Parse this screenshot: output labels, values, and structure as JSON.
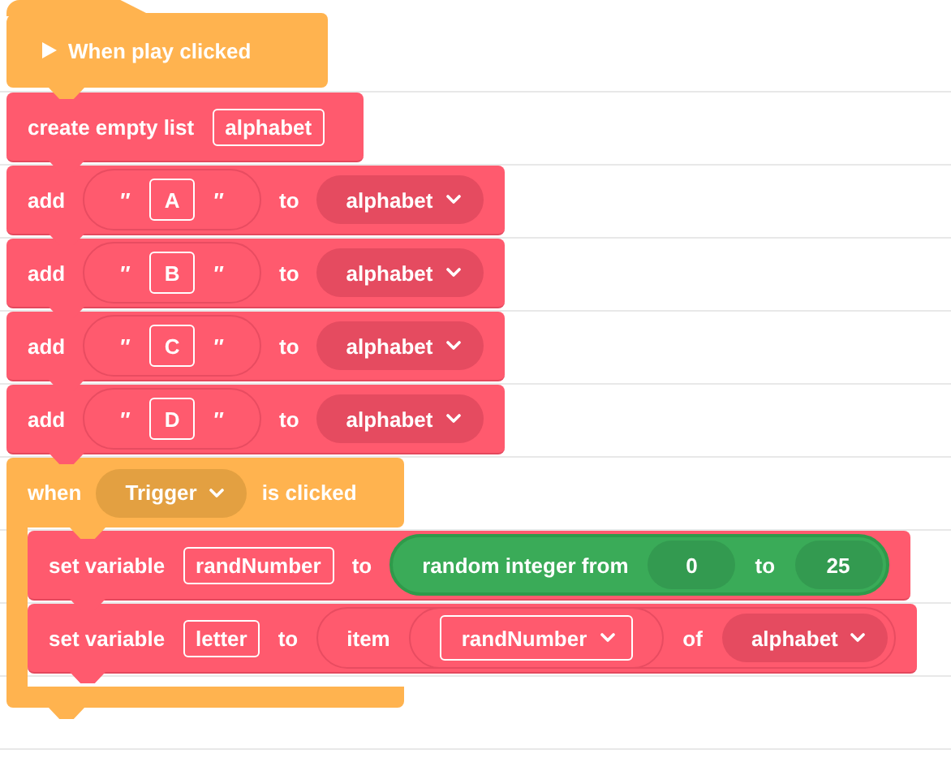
{
  "scripts": [
    {
      "hat": {
        "kind": "play",
        "label": "When play clicked"
      },
      "blocks": [
        {
          "kind": "command",
          "parts": [
            {
              "kind": "label",
              "text": "create empty list"
            },
            {
              "kind": "field",
              "text": "alphabet"
            }
          ]
        },
        {
          "kind": "command",
          "parts": [
            {
              "kind": "label",
              "text": "add"
            },
            {
              "kind": "string",
              "open": "″",
              "value": "A",
              "close": "″"
            },
            {
              "kind": "label",
              "text": "to"
            },
            {
              "kind": "dropdown",
              "text": "alphabet"
            }
          ]
        },
        {
          "kind": "command",
          "parts": [
            {
              "kind": "label",
              "text": "add"
            },
            {
              "kind": "string",
              "open": "″",
              "value": "B",
              "close": "″"
            },
            {
              "kind": "label",
              "text": "to"
            },
            {
              "kind": "dropdown",
              "text": "alphabet"
            }
          ]
        },
        {
          "kind": "command",
          "parts": [
            {
              "kind": "label",
              "text": "add"
            },
            {
              "kind": "string",
              "open": "″",
              "value": "C",
              "close": "″"
            },
            {
              "kind": "label",
              "text": "to"
            },
            {
              "kind": "dropdown",
              "text": "alphabet"
            }
          ]
        },
        {
          "kind": "command",
          "parts": [
            {
              "kind": "label",
              "text": "add"
            },
            {
              "kind": "string",
              "open": "″",
              "value": "D",
              "close": "″"
            },
            {
              "kind": "label",
              "text": "to"
            },
            {
              "kind": "dropdown",
              "text": "alphabet"
            }
          ]
        },
        {
          "kind": "event",
          "parts": [
            {
              "kind": "label",
              "text": "when"
            },
            {
              "kind": "dropdown",
              "text": "Trigger"
            },
            {
              "kind": "label",
              "text": "is clicked"
            }
          ],
          "children": [
            {
              "kind": "command",
              "parts": [
                {
                  "kind": "label",
                  "text": "set variable"
                },
                {
                  "kind": "field",
                  "text": "randNumber"
                },
                {
                  "kind": "label",
                  "text": "to"
                },
                {
                  "kind": "operator_reporter",
                  "parts": [
                    {
                      "kind": "label",
                      "text": "random integer from"
                    },
                    {
                      "kind": "number",
                      "text": "0"
                    },
                    {
                      "kind": "label",
                      "text": "to"
                    },
                    {
                      "kind": "number",
                      "text": "25"
                    }
                  ]
                }
              ]
            },
            {
              "kind": "command",
              "parts": [
                {
                  "kind": "label",
                  "text": "set variable"
                },
                {
                  "kind": "field",
                  "text": "letter"
                },
                {
                  "kind": "label",
                  "text": "to"
                },
                {
                  "kind": "list_reporter",
                  "parts": [
                    {
                      "kind": "label",
                      "text": "item"
                    },
                    {
                      "kind": "variable",
                      "text": "randNumber"
                    },
                    {
                      "kind": "label",
                      "text": "of"
                    },
                    {
                      "kind": "dropdown",
                      "text": "alphabet"
                    }
                  ]
                }
              ]
            }
          ]
        }
      ]
    }
  ]
}
